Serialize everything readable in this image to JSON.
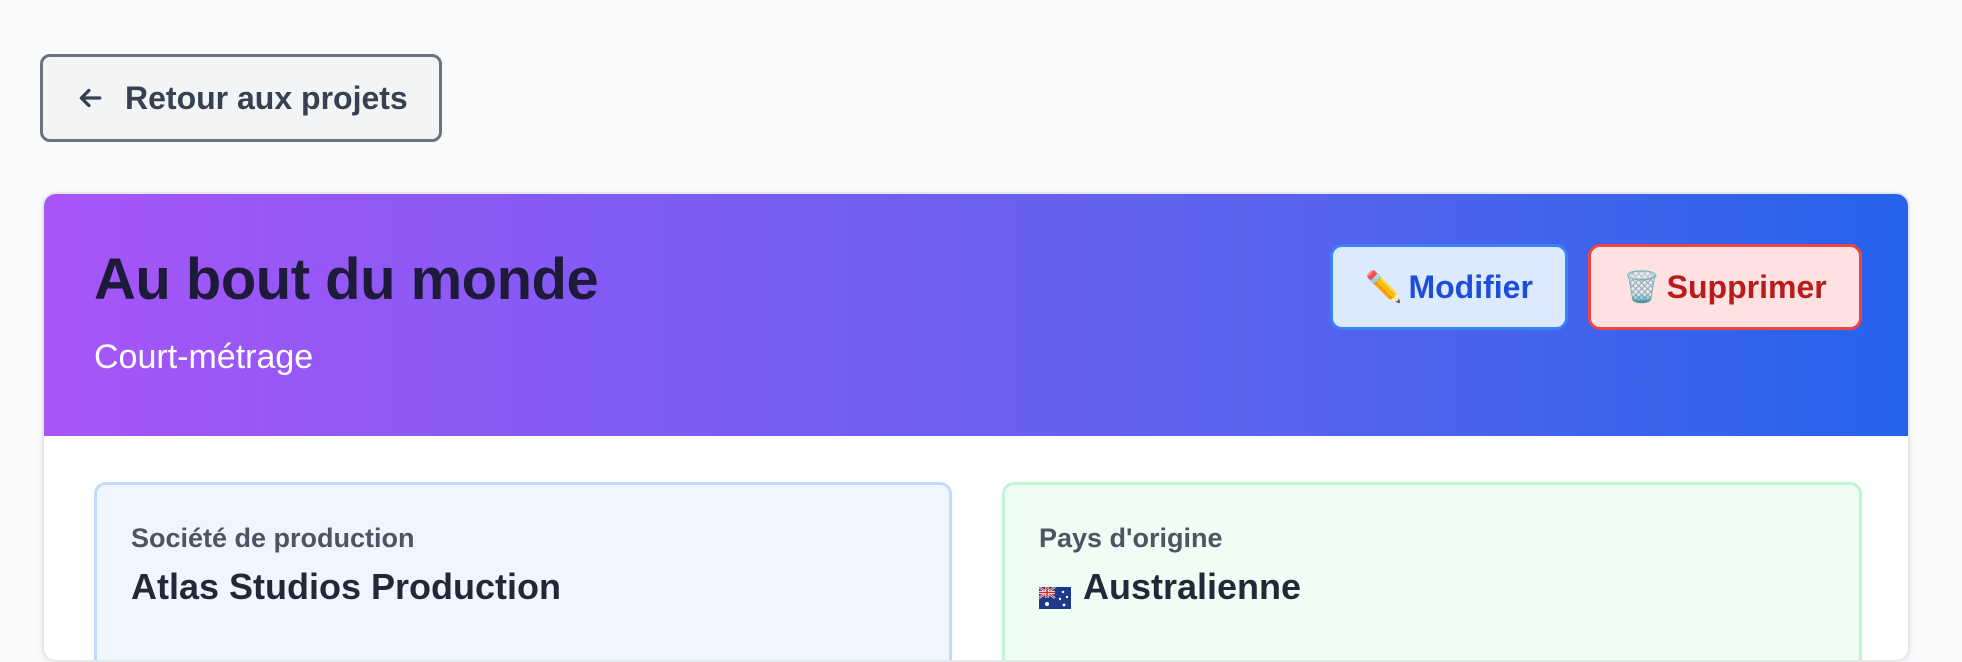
{
  "nav": {
    "back_label": "Retour aux projets",
    "back_icon": "arrow-left-icon"
  },
  "project": {
    "title": "Au bout du monde",
    "type": "Court-métrage"
  },
  "actions": {
    "edit_label": "Modifier",
    "edit_icon": "✏️",
    "delete_label": "Supprimer",
    "delete_icon": "🗑️"
  },
  "details": {
    "production_label": "Société de production",
    "production_value": "Atlas Studios Production",
    "country_label": "Pays d'origine",
    "country_value": "Australienne",
    "country_flag": "australia-flag-icon"
  },
  "colors": {
    "gradient_start": "#a855f7",
    "gradient_end": "#2563eb",
    "edit_accent": "#3b82f6",
    "delete_accent": "#ef4444"
  }
}
